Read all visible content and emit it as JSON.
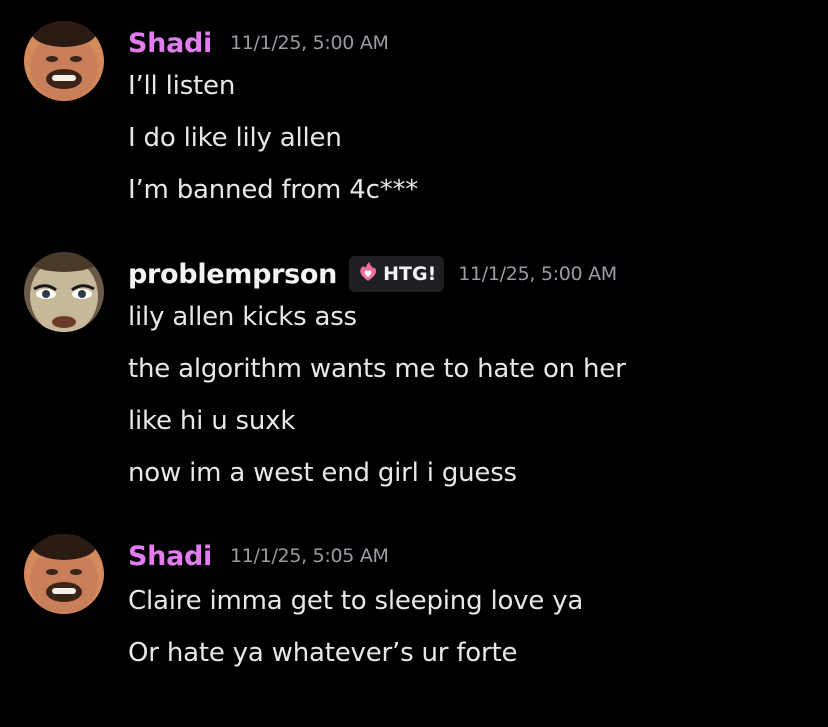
{
  "colors": {
    "background": "#000000",
    "shadi_name": "#e27cf0",
    "problemprson_name": "#f2f3f5",
    "timestamp": "#9a9ba3",
    "message_text": "#e6e7ea",
    "tag_bg": "#1e1f22",
    "tag_icon": "#f06fa0"
  },
  "messages": [
    {
      "author": "Shadi",
      "timestamp": "11/1/25, 5:00 AM",
      "avatar": "shadi-avatar",
      "lines": [
        "I’ll listen",
        "I do like lily allen",
        "I’m banned from 4c***"
      ]
    },
    {
      "author": "problemprson",
      "tag": {
        "icon": "flame-heart-icon",
        "label": "HTG!"
      },
      "timestamp": "11/1/25, 5:00 AM",
      "avatar": "problemprson-avatar",
      "lines": [
        "lily allen kicks ass",
        "the algorithm wants me to hate on her",
        "like hi u suxk",
        "now im a west end girl i guess"
      ]
    },
    {
      "author": "Shadi",
      "timestamp": "11/1/25, 5:05 AM",
      "avatar": "shadi-avatar",
      "lines": [
        "Claire imma get to sleeping love ya",
        "Or hate ya whatever’s ur forte"
      ]
    }
  ]
}
